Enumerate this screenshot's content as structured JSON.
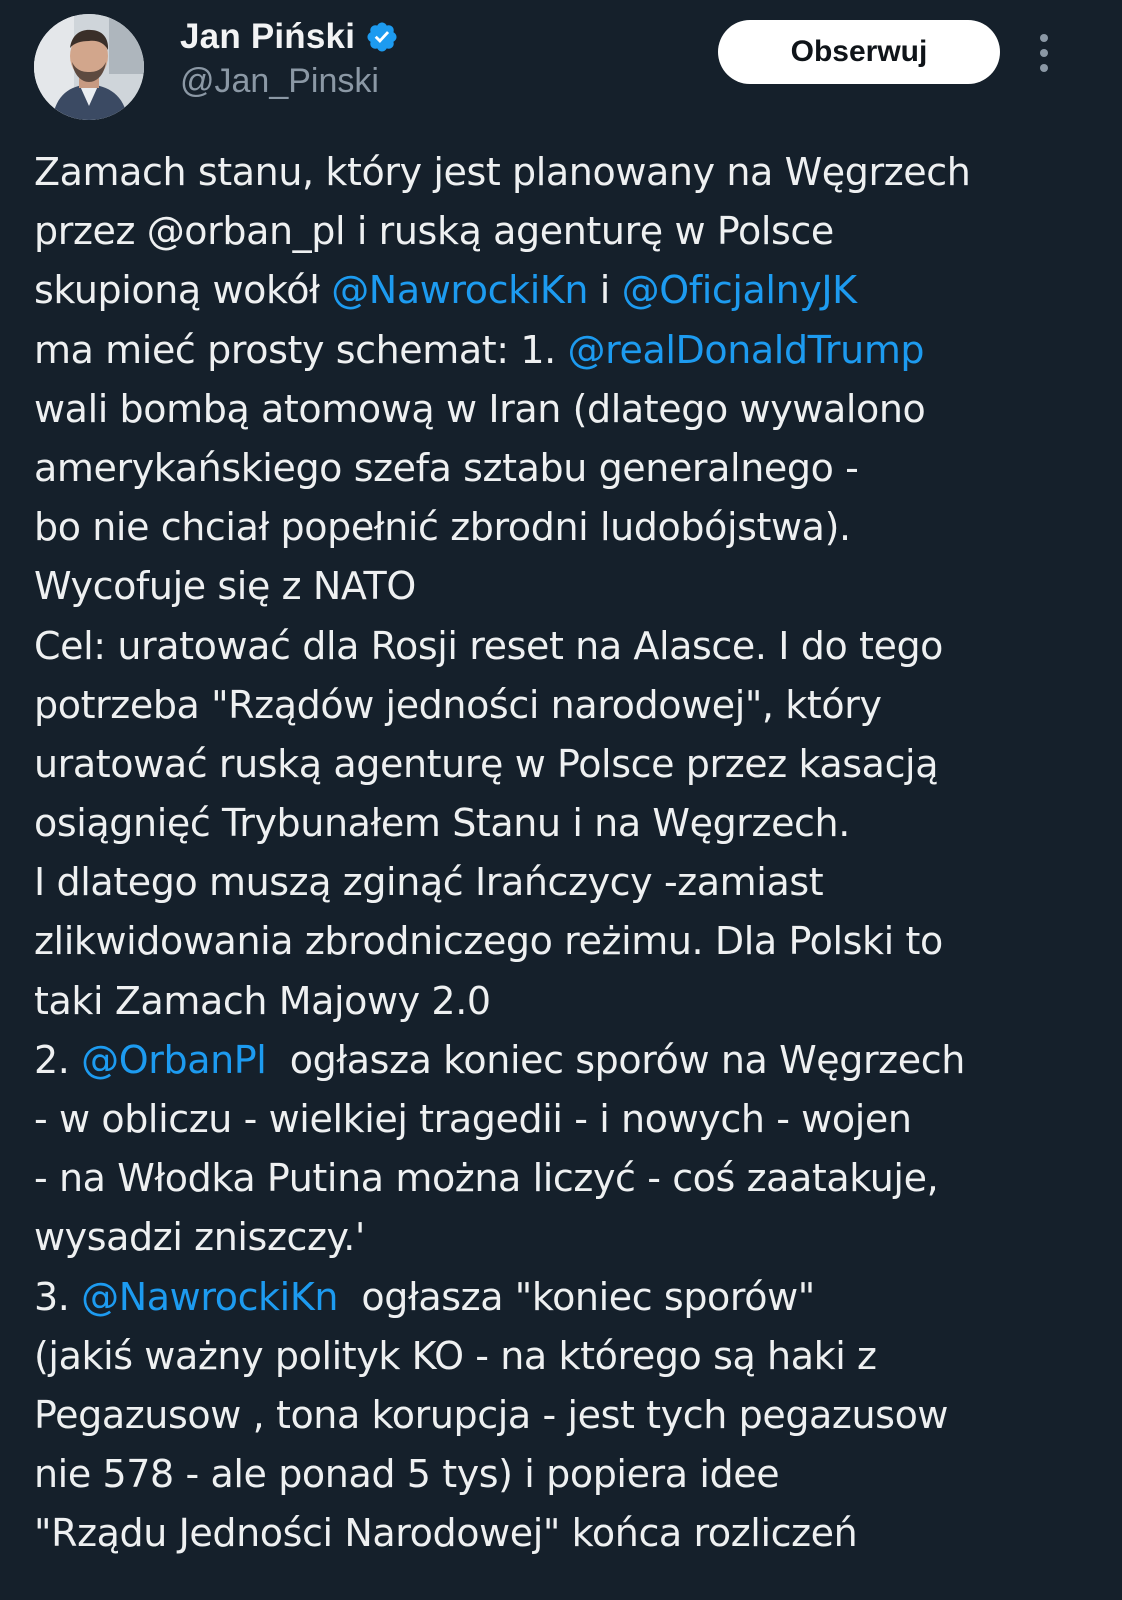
{
  "author": {
    "name": "Jan Piński",
    "handle": "@Jan_Pinski",
    "verified": true,
    "verified_color": "#1d9bf0"
  },
  "actions": {
    "follow_label": "Obserwuj"
  },
  "tweet": {
    "lines": [
      {
        "parts": [
          {
            "t": "text",
            "v": "Zamach stanu, który jest planowany na Węgrzech"
          }
        ]
      },
      {
        "parts": [
          {
            "t": "text",
            "v": "przez @orban_pl i ruską agenturę w Polsce"
          }
        ]
      },
      {
        "parts": [
          {
            "t": "text",
            "v": "skupioną wokół "
          },
          {
            "t": "mention",
            "v": "@NawrockiKn"
          },
          {
            "t": "text",
            "v": " i "
          },
          {
            "t": "mention",
            "v": "@OficjalnyJK"
          }
        ]
      },
      {
        "parts": [
          {
            "t": "text",
            "v": "ma mieć prosty schemat: 1. "
          },
          {
            "t": "mention",
            "v": "@realDonaldTrump"
          }
        ]
      },
      {
        "parts": [
          {
            "t": "text",
            "v": "wali bombą atomową w Iran (dlatego wywalono"
          }
        ]
      },
      {
        "parts": [
          {
            "t": "text",
            "v": "amerykańskiego szefa sztabu generalnego -"
          }
        ]
      },
      {
        "parts": [
          {
            "t": "text",
            "v": "bo nie chciał popełnić zbrodni ludobójstwa)."
          }
        ]
      },
      {
        "parts": [
          {
            "t": "text",
            "v": "Wycofuje się z NATO"
          }
        ]
      },
      {
        "parts": [
          {
            "t": "text",
            "v": "Cel: uratować dla Rosji reset na Alasce. I do tego"
          }
        ]
      },
      {
        "parts": [
          {
            "t": "text",
            "v": "potrzeba \"Rządów jedności narodowej\", który"
          }
        ]
      },
      {
        "parts": [
          {
            "t": "text",
            "v": "uratować ruską agenturę w Polsce przez kasacją"
          }
        ]
      },
      {
        "parts": [
          {
            "t": "text",
            "v": "osiągnięć Trybunałem Stanu i na Węgrzech."
          }
        ]
      },
      {
        "parts": [
          {
            "t": "text",
            "v": "I dlatego muszą zginąć Irańczycy -zamiast"
          }
        ]
      },
      {
        "parts": [
          {
            "t": "text",
            "v": "zlikwidowania zbrodniczego reżimu. Dla Polski to"
          }
        ]
      },
      {
        "parts": [
          {
            "t": "text",
            "v": "taki Zamach Majowy 2.0"
          }
        ]
      },
      {
        "parts": [
          {
            "t": "text",
            "v": "2. "
          },
          {
            "t": "mention",
            "v": "@OrbanPl"
          },
          {
            "t": "text",
            "v": "  ogłasza koniec sporów na Węgrzech"
          }
        ]
      },
      {
        "parts": [
          {
            "t": "text",
            "v": "- w obliczu - wielkiej tragedii - i nowych - wojen"
          }
        ]
      },
      {
        "parts": [
          {
            "t": "text",
            "v": "- na Włodka Putina można liczyć - coś zaatakuje,"
          }
        ]
      },
      {
        "parts": [
          {
            "t": "text",
            "v": "wysadzi zniszczy.'"
          }
        ]
      },
      {
        "parts": [
          {
            "t": "text",
            "v": "3. "
          },
          {
            "t": "mention",
            "v": "@NawrockiKn"
          },
          {
            "t": "text",
            "v": "  ogłasza \"koniec sporów\""
          }
        ]
      },
      {
        "parts": [
          {
            "t": "text",
            "v": "(jakiś ważny polityk KO - na którego są haki z"
          }
        ]
      },
      {
        "parts": [
          {
            "t": "text",
            "v": "Pegazusow , tona korupcja - jest tych pegazusow"
          }
        ]
      },
      {
        "parts": [
          {
            "t": "text",
            "v": "nie 578 - ale ponad 5 tys) i popiera idee"
          }
        ]
      },
      {
        "parts": [
          {
            "t": "text",
            "v": "\"Rządu Jedności Narodowej\" końca rozliczeń"
          }
        ]
      }
    ]
  },
  "colors": {
    "background": "#15202b",
    "text": "#eef0f1",
    "secondary_text": "#8b98a5",
    "link": "#1d9bf0",
    "follow_button_bg": "#ffffff"
  },
  "icons": {
    "verified": "verified-badge-icon",
    "more": "more-options-icon",
    "avatar": "profile-photo"
  }
}
